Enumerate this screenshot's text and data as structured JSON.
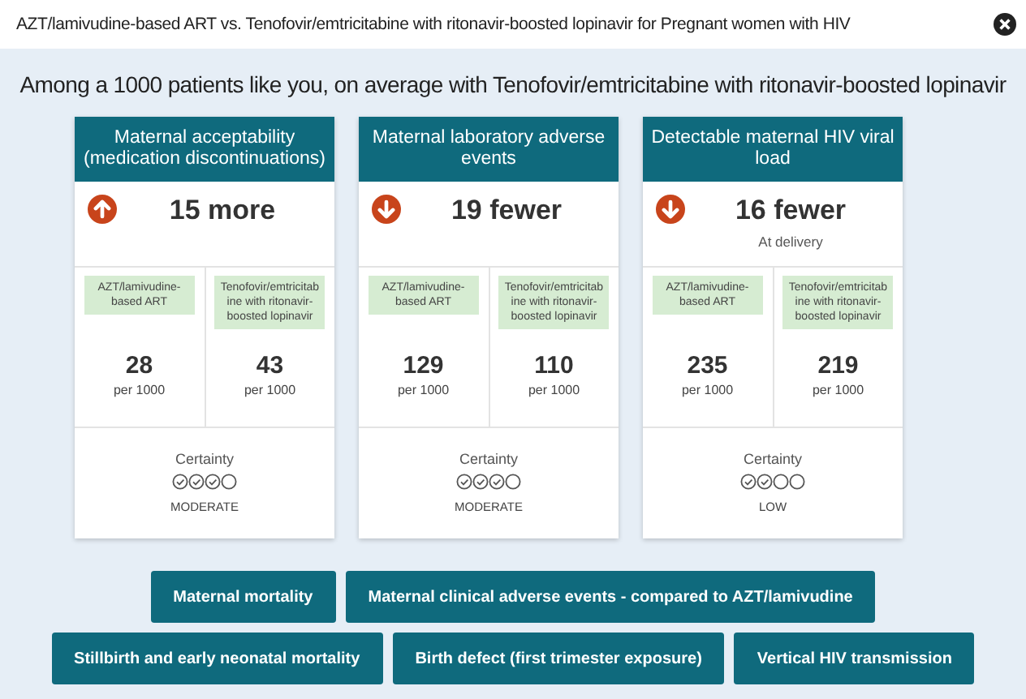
{
  "window": {
    "title": "AZT/lamivudine-based ART vs. Tenofovir/emtricitabine with ritonavir-boosted lopinavir for Pregnant women with HIV"
  },
  "heading": "Among a 1000 patients like you, on average with Tenofovir/emtricitabine with ritonavir-boosted lopinavir",
  "cards": [
    {
      "title": "Maternal acceptability (medication discontinuations)",
      "increase": true,
      "effect": "15 more",
      "arms": [
        {
          "label": "AZT/lamivudine-based ART",
          "value": "28",
          "unit": "per 1000"
        },
        {
          "label": "Tenofovir/emtricitabine with ritonavir-boosted lopinavir",
          "value": "43",
          "unit": "per 1000"
        }
      ],
      "certainty": {
        "label": "Certainty",
        "circles": [
          {
            "checked": true
          },
          {
            "checked": true
          },
          {
            "checked": true
          },
          {
            "checked": false
          }
        ],
        "rating": "MODERATE"
      }
    },
    {
      "title": "Maternal laboratory adverse events",
      "increase": false,
      "effect": "19 fewer",
      "arms": [
        {
          "label": "AZT/lamivudine-based ART",
          "value": "129",
          "unit": "per 1000"
        },
        {
          "label": "Tenofovir/emtricitabine with ritonavir-boosted lopinavir",
          "value": "110",
          "unit": "per 1000"
        }
      ],
      "certainty": {
        "label": "Certainty",
        "circles": [
          {
            "checked": true
          },
          {
            "checked": true
          },
          {
            "checked": true
          },
          {
            "checked": false
          }
        ],
        "rating": "MODERATE"
      }
    },
    {
      "title": "Detectable maternal HIV viral load",
      "increase": false,
      "effect": "16 fewer",
      "note": "At delivery",
      "arms": [
        {
          "label": "AZT/lamivudine-based ART",
          "value": "235",
          "unit": "per 1000"
        },
        {
          "label": "Tenofovir/emtricitabine with ritonavir-boosted lopinavir",
          "value": "219",
          "unit": "per 1000"
        }
      ],
      "certainty": {
        "label": "Certainty",
        "circles": [
          {
            "checked": true
          },
          {
            "checked": true
          },
          {
            "checked": false
          },
          {
            "checked": false
          }
        ],
        "rating": "LOW"
      }
    }
  ],
  "outcome_buttons": [
    [
      "Maternal mortality",
      "Maternal clinical adverse events - compared to AZT/lamivudine"
    ],
    [
      "Stillbirth and early neonatal mortality",
      "Birth defect (first trimester exposure)",
      "Vertical HIV transmission"
    ]
  ]
}
